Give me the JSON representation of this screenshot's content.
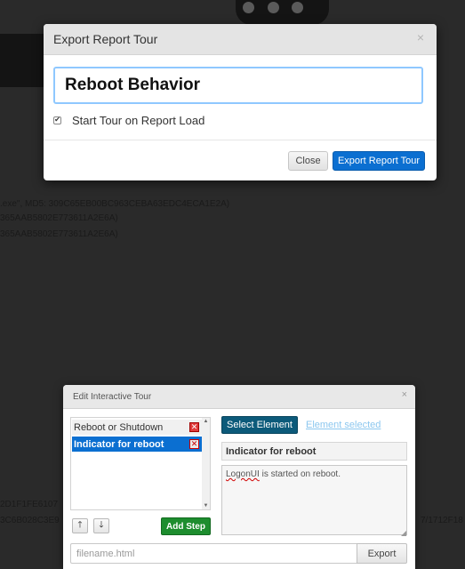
{
  "background": {
    "lines": [
      ".exe\", MD5: 309C65EB00BC963CEBA63EDC4ECA1E2A)",
      "365AAB5802E773611A2E6A)",
      "365AAB5802E773611A2E6A)",
      "2D1F1FE6107",
      "3C6B028C3E9",
      "7/1712F18"
    ]
  },
  "export_modal": {
    "title": "Export Report Tour",
    "close_symbol": "×",
    "tour_name_value": "Reboot Behavior",
    "start_on_load_label": "Start Tour on Report Load",
    "start_on_load_checked": true,
    "close_button_label": "Close",
    "export_button_label": "Export Report Tour",
    "accent_color": "#0b6fd1"
  },
  "tour_panel": {
    "title": "Edit Interactive Tour",
    "close_symbol": "×",
    "steps": [
      {
        "label": "Reboot or Shutdown",
        "selected": false
      },
      {
        "label": "Indicator for reboot",
        "selected": true
      }
    ],
    "move_up_symbol": "🡑",
    "move_down_symbol": "🡓",
    "add_step_label": "Add Step",
    "select_element_label": "Select Element",
    "element_selected_label": "Element selected",
    "step_title_value": "Indicator for reboot",
    "step_body_misspelled": "LogonUI",
    "step_body_rest": " is started on reboot.",
    "filename_placeholder": "filename.html",
    "export_label": "Export"
  }
}
